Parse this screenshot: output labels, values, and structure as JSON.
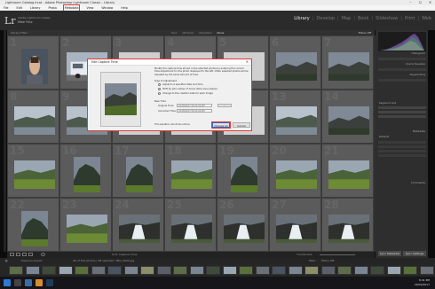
{
  "window": {
    "title": "Lightroom Catalog.lrcat - Adobe Photoshop Lightroom Classic - Library",
    "controls": [
      "–",
      "☐",
      "✕"
    ]
  },
  "menubar": {
    "items": [
      "File",
      "Edit",
      "Library",
      "Photo",
      "Metadata",
      "View",
      "Window",
      "Help"
    ],
    "highlighted": "Metadata"
  },
  "identity": {
    "logo": "Lr",
    "line1": "Adobe Lightroom Classic",
    "line2": "Mike Fritz",
    "modules": [
      "Library",
      "Develop",
      "Map",
      "Book",
      "Slideshow",
      "Print",
      "Web"
    ],
    "active_module": "Library"
  },
  "filterbar": {
    "label": "Library Filter :",
    "tabs": [
      "Text",
      "Attribute",
      "Metadata",
      "None"
    ],
    "active_tab": "None",
    "preset": "Filters Off"
  },
  "grid": {
    "cells": [
      {
        "num": "1",
        "scene": "selfie"
      },
      {
        "num": "2",
        "scene": "van"
      },
      {
        "num": "3",
        "scene": "blank"
      },
      {
        "num": "4",
        "scene": "blank"
      },
      {
        "num": "5",
        "scene": "blank"
      },
      {
        "num": "6",
        "scene": "dark-landscape"
      },
      {
        "num": "7",
        "scene": "dark-landscape"
      },
      {
        "num": "8",
        "scene": "coast"
      },
      {
        "num": "9",
        "scene": "coast"
      },
      {
        "num": "10",
        "scene": "blank"
      },
      {
        "num": "11",
        "scene": "blank"
      },
      {
        "num": "12",
        "scene": "blank"
      },
      {
        "num": "13",
        "scene": "coast"
      },
      {
        "num": "14",
        "scene": "dark-landscape"
      },
      {
        "num": "15",
        "scene": "meadow"
      },
      {
        "num": "16",
        "scene": "hill"
      },
      {
        "num": "17",
        "scene": "hill"
      },
      {
        "num": "18",
        "scene": "meadow"
      },
      {
        "num": "19",
        "scene": "hill"
      },
      {
        "num": "20",
        "scene": "meadow"
      },
      {
        "num": "21",
        "scene": "meadow"
      },
      {
        "num": "22",
        "scene": "hill"
      },
      {
        "num": "23",
        "scene": "meadow"
      },
      {
        "num": "24",
        "scene": "waterfall"
      },
      {
        "num": "25",
        "scene": "waterfall"
      },
      {
        "num": "26",
        "scene": "waterfall"
      },
      {
        "num": "27",
        "scene": "waterfall"
      },
      {
        "num": "28",
        "scene": "waterfall"
      }
    ]
  },
  "toolbar": {
    "sort_label": "Sort: Capture Time",
    "thumbnails_label": "Thumbnails"
  },
  "rightpanel": {
    "histogram_label": "Histogram",
    "sections": [
      "Quick Develop",
      "Keywording",
      "Keyword List",
      "Metadata",
      "Comments"
    ],
    "metadata_preset": "Default",
    "sync_metadata": "Sync Metadata",
    "sync_settings": "Sync Settings"
  },
  "filmstrip": {
    "source": "Previous Import",
    "count_label": "40 of 312 photos / 28 selected / IMG_5093.jpg",
    "filter_label": "Filter :",
    "filter_value": "Filters Off"
  },
  "dialog": {
    "title": "Edit Capture Time",
    "description": "Modify the capture time stored in the selected photos by entering the correct time adjustment for the photo displayed to the left. Other selected photos will be adjusted by the same amount of time.",
    "type_label": "Type of Adjustment",
    "options": [
      "Adjust to a specified date and time",
      "Shift by set number of hours (time zone adjust)",
      "Change to the creation date for each image"
    ],
    "selected_option": 1,
    "new_time_label": "New Time",
    "original_label": "Original Time:",
    "original_value": "16/09/2017 08:22:09 PM",
    "corrected_label": "Corrected Time:",
    "corrected_value": "16/09/2017 08:22:09 PM",
    "hour_field": "0",
    "note": "This operation cannot be undone.",
    "ok_label": "Change All",
    "cancel_label": "Cancel"
  },
  "taskbar": {
    "time": "8:41 PM",
    "date": "18/09/2017"
  }
}
